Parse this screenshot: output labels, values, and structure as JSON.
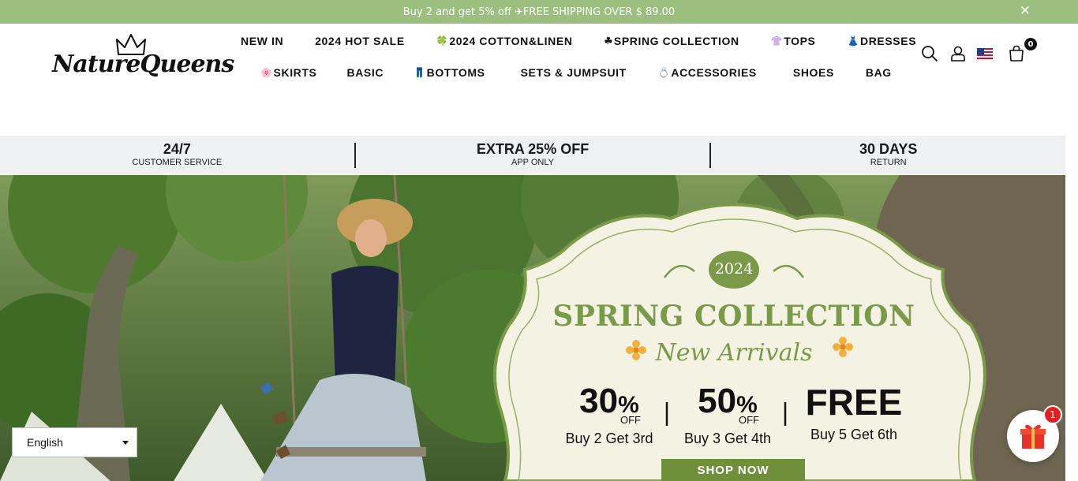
{
  "announcement": {
    "text": "Buy 2 and get 5% off ✈FREE SHIPPING OVER $ 89.00",
    "close_glyph": "✕"
  },
  "brand": {
    "logo_text": "NatureQueens"
  },
  "nav": {
    "row1": [
      {
        "label": "NEW IN"
      },
      {
        "label": "2024 HOT SALE"
      },
      {
        "icon": "🍀",
        "label": "2024 COTTON&LINEN"
      },
      {
        "icon": "☘",
        "label": "SPRING COLLECTION"
      },
      {
        "icon": "👚",
        "label": "TOPS"
      },
      {
        "icon": "👗",
        "label": "DRESSES"
      }
    ],
    "row2": [
      {
        "icon": "🌸",
        "label": "SKIRTS"
      },
      {
        "label": "BASIC"
      },
      {
        "icon": "👖",
        "label": "BOTTOMS"
      },
      {
        "label": "SETS & JUMPSUIT"
      },
      {
        "icon": "💍",
        "label": "ACCESSORIES"
      },
      {
        "label": "SHOES"
      },
      {
        "label": "BAG"
      }
    ]
  },
  "header_icons": {
    "search": "search-icon",
    "account": "user-icon",
    "flag": "us-flag-icon",
    "cart": "bag-icon",
    "cart_count": "0"
  },
  "benefits": [
    {
      "big": "24/7",
      "small": "CUSTOMER SERVICE"
    },
    {
      "big": "EXTRA 25% OFF",
      "small": "APP ONLY"
    },
    {
      "big": "30 DAYS",
      "small": "RETURN"
    }
  ],
  "hero": {
    "badge_year": "2024",
    "title": "SPRING COLLECTION",
    "subtitle": "New Arrivals",
    "offers": [
      {
        "value": "30",
        "unit": "%",
        "off": "OFF",
        "desc": "Buy 2 Get 3rd"
      },
      {
        "value": "50",
        "unit": "%",
        "off": "OFF",
        "desc": "Buy 3 Get 4th"
      },
      {
        "value": "FREE",
        "desc": "Buy 5 Get 6th"
      }
    ],
    "cta": "SHOP NOW"
  },
  "language": {
    "selected": "English"
  },
  "gift_widget": {
    "count": "1"
  },
  "colors": {
    "announce": "#9cbf7f",
    "accent_green": "#7a9a4a",
    "badge_red": "#e02020"
  }
}
